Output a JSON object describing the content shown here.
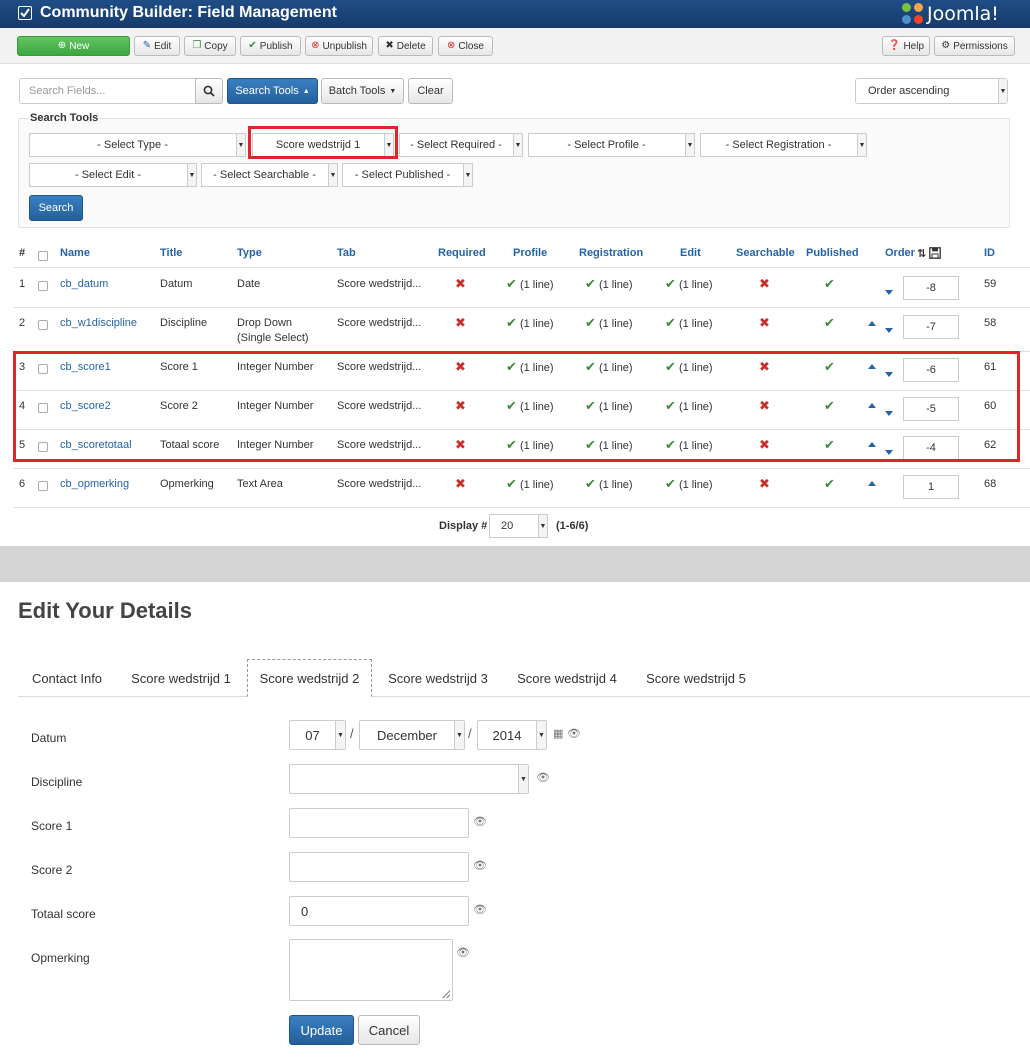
{
  "app": {
    "title": "Community Builder: Field Management",
    "logo_text": "Joomla!"
  },
  "toolbar": {
    "new": "New",
    "edit": "Edit",
    "copy": "Copy",
    "publish": "Publish",
    "unpublish": "Unpublish",
    "delete": "Delete",
    "close": "Close",
    "help": "Help",
    "permissions": "Permissions"
  },
  "search": {
    "placeholder": "Search Fields...",
    "search_tools": "Search Tools",
    "batch_tools": "Batch Tools",
    "clear": "Clear",
    "order": "Order ascending"
  },
  "filters": {
    "label": "Search Tools",
    "type": "- Select Type -",
    "tab": "Score wedstrijd 1",
    "required": "- Select Required -",
    "profile": "- Select Profile -",
    "registration": "- Select Registration -",
    "edit": "- Select Edit -",
    "searchable": "- Select Searchable -",
    "published": "- Select Published -",
    "search_button": "Search"
  },
  "table": {
    "headers": {
      "num": "#",
      "name": "Name",
      "title": "Title",
      "type": "Type",
      "tab": "Tab",
      "required": "Required",
      "profile": "Profile",
      "registration": "Registration",
      "edit": "Edit",
      "searchable": "Searchable",
      "published": "Published",
      "order": "Order",
      "id": "ID"
    },
    "line_text": "(1 line)",
    "rows": [
      {
        "num": "1",
        "name": "cb_datum",
        "title": "Datum",
        "type": "Date",
        "type2": "",
        "tab": "Score wedstrijd...",
        "order": "-8",
        "id": "59"
      },
      {
        "num": "2",
        "name": "cb_w1discipline",
        "title": "Discipline",
        "type": "Drop Down",
        "type2": "(Single Select)",
        "tab": "Score wedstrijd...",
        "order": "-7",
        "id": "58"
      },
      {
        "num": "3",
        "name": "cb_score1",
        "title": "Score 1",
        "type": "Integer Number",
        "type2": "",
        "tab": "Score wedstrijd...",
        "order": "-6",
        "id": "61"
      },
      {
        "num": "4",
        "name": "cb_score2",
        "title": "Score 2",
        "type": "Integer Number",
        "type2": "",
        "tab": "Score wedstrijd...",
        "order": "-5",
        "id": "60"
      },
      {
        "num": "5",
        "name": "cb_scoretotaal",
        "title": "Totaal score",
        "type": "Integer Number",
        "type2": "",
        "tab": "Score wedstrijd...",
        "order": "-4",
        "id": "62"
      },
      {
        "num": "6",
        "name": "cb_opmerking",
        "title": "Opmerking",
        "type": "Text Area",
        "type2": "",
        "tab": "Score wedstrijd...",
        "order": "1",
        "id": "68"
      }
    ]
  },
  "pagination": {
    "label": "Display #",
    "value": "20",
    "range": "(1-6/6)"
  },
  "profile_edit": {
    "heading": "Edit Your Details",
    "tabs": [
      "Contact Info",
      "Score wedstrijd 1",
      "Score wedstrijd 2",
      "Score wedstrijd 3",
      "Score wedstrijd 4",
      "Score wedstrijd 5"
    ],
    "active_tab": "Score wedstrijd 2",
    "fields": {
      "datum_label": "Datum",
      "day": "07",
      "month": "December",
      "year": "2014",
      "discipline_label": "Discipline",
      "discipline_value": "",
      "score1_label": "Score 1",
      "score1_value": "",
      "score2_label": "Score 2",
      "score2_value": "",
      "total_label": "Totaal score",
      "total_value": "0",
      "remark_label": "Opmerking",
      "remark_value": ""
    },
    "update": "Update",
    "cancel": "Cancel"
  },
  "colors": {
    "brand_blue": "#163b6b",
    "link_blue": "#2463a7",
    "check_green": "#3c8b3c",
    "cross_red": "#c9302c",
    "highlight_red": "#e0242b"
  },
  "icons": [
    "check-icon",
    "cross-icon",
    "plus-icon",
    "pencil-icon",
    "copy-icon",
    "help-icon",
    "gear-icon",
    "search-icon",
    "calendar-icon",
    "eye-icon",
    "save-icon",
    "sort-icon"
  ]
}
